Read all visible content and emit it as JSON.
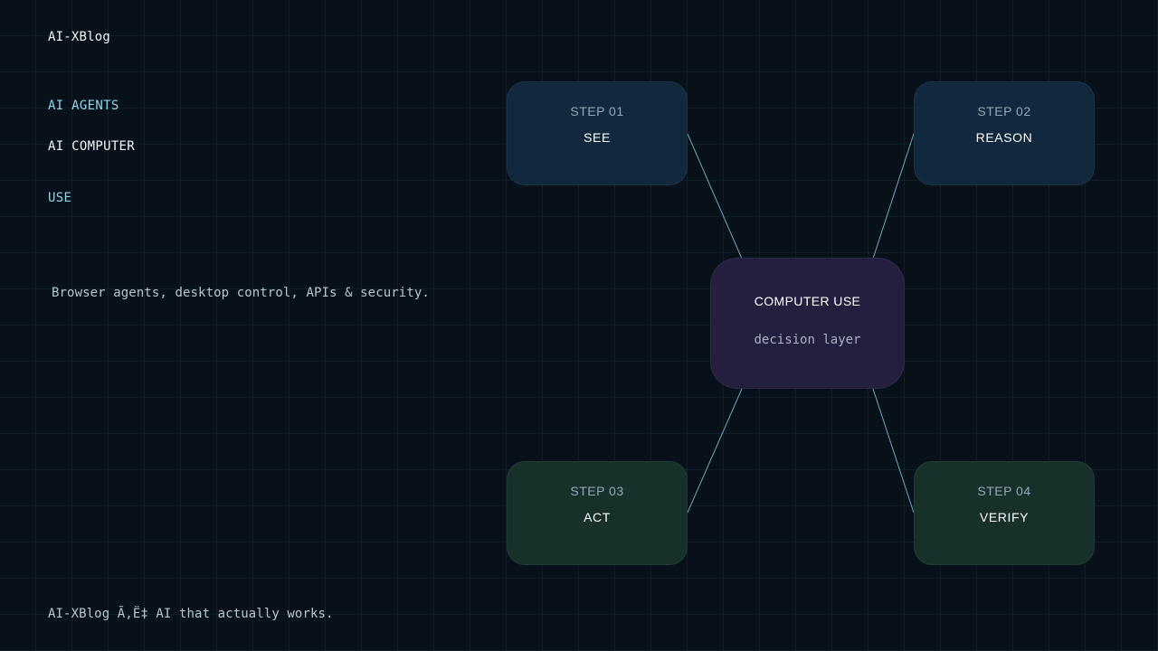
{
  "brand": {
    "name": "AI-XBlog"
  },
  "headline": {
    "line1": "AI AGENTS",
    "line2": "AI COMPUTER",
    "line3": "USE"
  },
  "tagline": "Browser agents, desktop control, APIs & security.",
  "diagram": {
    "center": {
      "title": "COMPUTER USE",
      "subtitle": "decision layer"
    },
    "steps": [
      {
        "label": "STEP 01",
        "title": "SEE"
      },
      {
        "label": "STEP 02",
        "title": "REASON"
      },
      {
        "label": "STEP 03",
        "title": "ACT"
      },
      {
        "label": "STEP 04",
        "title": "VERIFY"
      }
    ]
  },
  "colors": {
    "background": "#08111a",
    "accent_text": "#8fd6ea",
    "connector": "#7fc6dc",
    "step_top_fill": "#12283f",
    "step_bottom_fill": "#17302a",
    "center_fill": "#241f3f"
  },
  "footer": "AI-XBlog Ã‚Ë‡ AI that actually works."
}
